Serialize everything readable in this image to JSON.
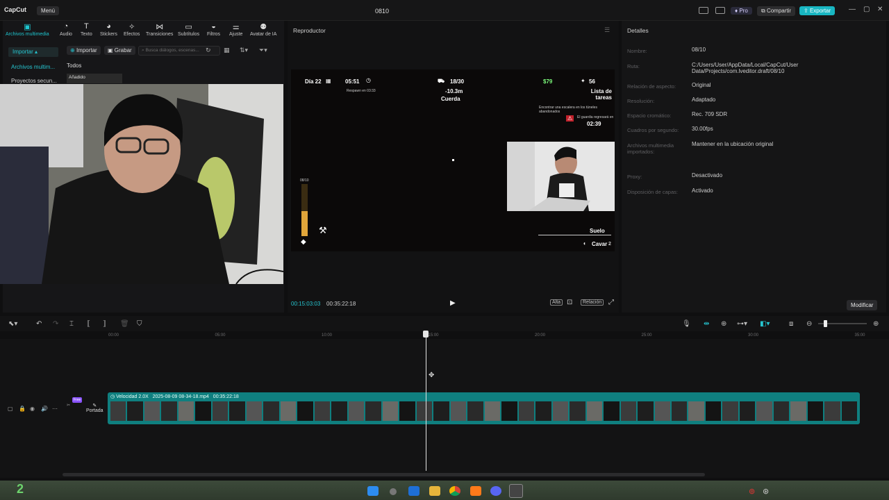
{
  "app": {
    "logo": "CapCut",
    "menu": "Menú",
    "project_title": "0810",
    "pro": "Pro",
    "share": "Compartir",
    "export": "Exportar"
  },
  "media_tools": [
    {
      "label": "Archivos multimedia",
      "icon": "media-icon",
      "active": true
    },
    {
      "label": "Audio",
      "icon": "audio-icon"
    },
    {
      "label": "Texto",
      "icon": "text-icon"
    },
    {
      "label": "Stickers",
      "icon": "sticker-icon"
    },
    {
      "label": "Efectos",
      "icon": "effects-icon"
    },
    {
      "label": "Transiciones",
      "icon": "transition-icon"
    },
    {
      "label": "Subtítulos",
      "icon": "subtitle-icon"
    },
    {
      "label": "Filtros",
      "icon": "filter-icon"
    },
    {
      "label": "Ajuste",
      "icon": "adjust-icon"
    },
    {
      "label": "Avatar de IA",
      "icon": "ai-avatar-icon"
    }
  ],
  "sidebar": {
    "import": "Importar",
    "items": [
      "Archivos multim...",
      "Proyectos secun..."
    ]
  },
  "media_panel": {
    "import_btn": "Importar",
    "record_btn": "Grabar",
    "search_placeholder": "Busca diálogos, escenas...",
    "filter_all": "Todos",
    "added_label": "Añadido"
  },
  "player": {
    "title": "Reproductor",
    "current_time": "00:15:03:03",
    "total_time": "00:35:22:18",
    "ratio": "Relación"
  },
  "game_hud": {
    "day": "Día 22",
    "time": "05:51",
    "subtime": "Respawn en 03:33",
    "count": "18/30",
    "depth": "-10.3m",
    "rope": "Cuerda",
    "money": "$79",
    "score": "56",
    "tasks": "Lista de tareas",
    "task_note": "Encontrar una escalera en los túneles abandonados",
    "alert": "El guardia regresará en",
    "alert_time": "02:39",
    "bar_label": "08/10",
    "floor": "Suelo",
    "dig": "Cavar",
    "dig_key": "2"
  },
  "details": {
    "title": "Detalles",
    "rows": [
      {
        "label": "Nombre:",
        "value": "08/10"
      },
      {
        "label": "Ruta:",
        "value": "C:/Users/User/AppData/Local/CapCut/User Data/Projects/com.lveditor.draft/08/10"
      },
      {
        "label": "Relación de aspecto:",
        "value": "Original"
      },
      {
        "label": "Resolución:",
        "value": "Adaptado"
      },
      {
        "label": "Espacio cromático:",
        "value": "Rec. 709 SDR"
      },
      {
        "label": "Cuadros por segundo:",
        "value": "30.00fps"
      },
      {
        "label": "Archivos multimedia importados:",
        "value": "Mantener en la ubicación original"
      },
      {
        "label": "Proxy:",
        "value": "Desactivado"
      },
      {
        "label": "Disposición de capas:",
        "value": "Activado"
      }
    ],
    "modify": "Modificar"
  },
  "timeline": {
    "ticks": [
      "00:00",
      "05:00",
      "10:00",
      "15:00",
      "20:00",
      "25:00",
      "30:00",
      "35:00"
    ],
    "clip_speed": "Velocidad 2.0X",
    "clip_name": "2025-08-09 08-34-18.mp4",
    "clip_duration": "00:35:22:18",
    "cover": "Portada",
    "free": "Free",
    "playhead_fraction": 0.425
  },
  "taskbar": {
    "workspace": "2"
  }
}
